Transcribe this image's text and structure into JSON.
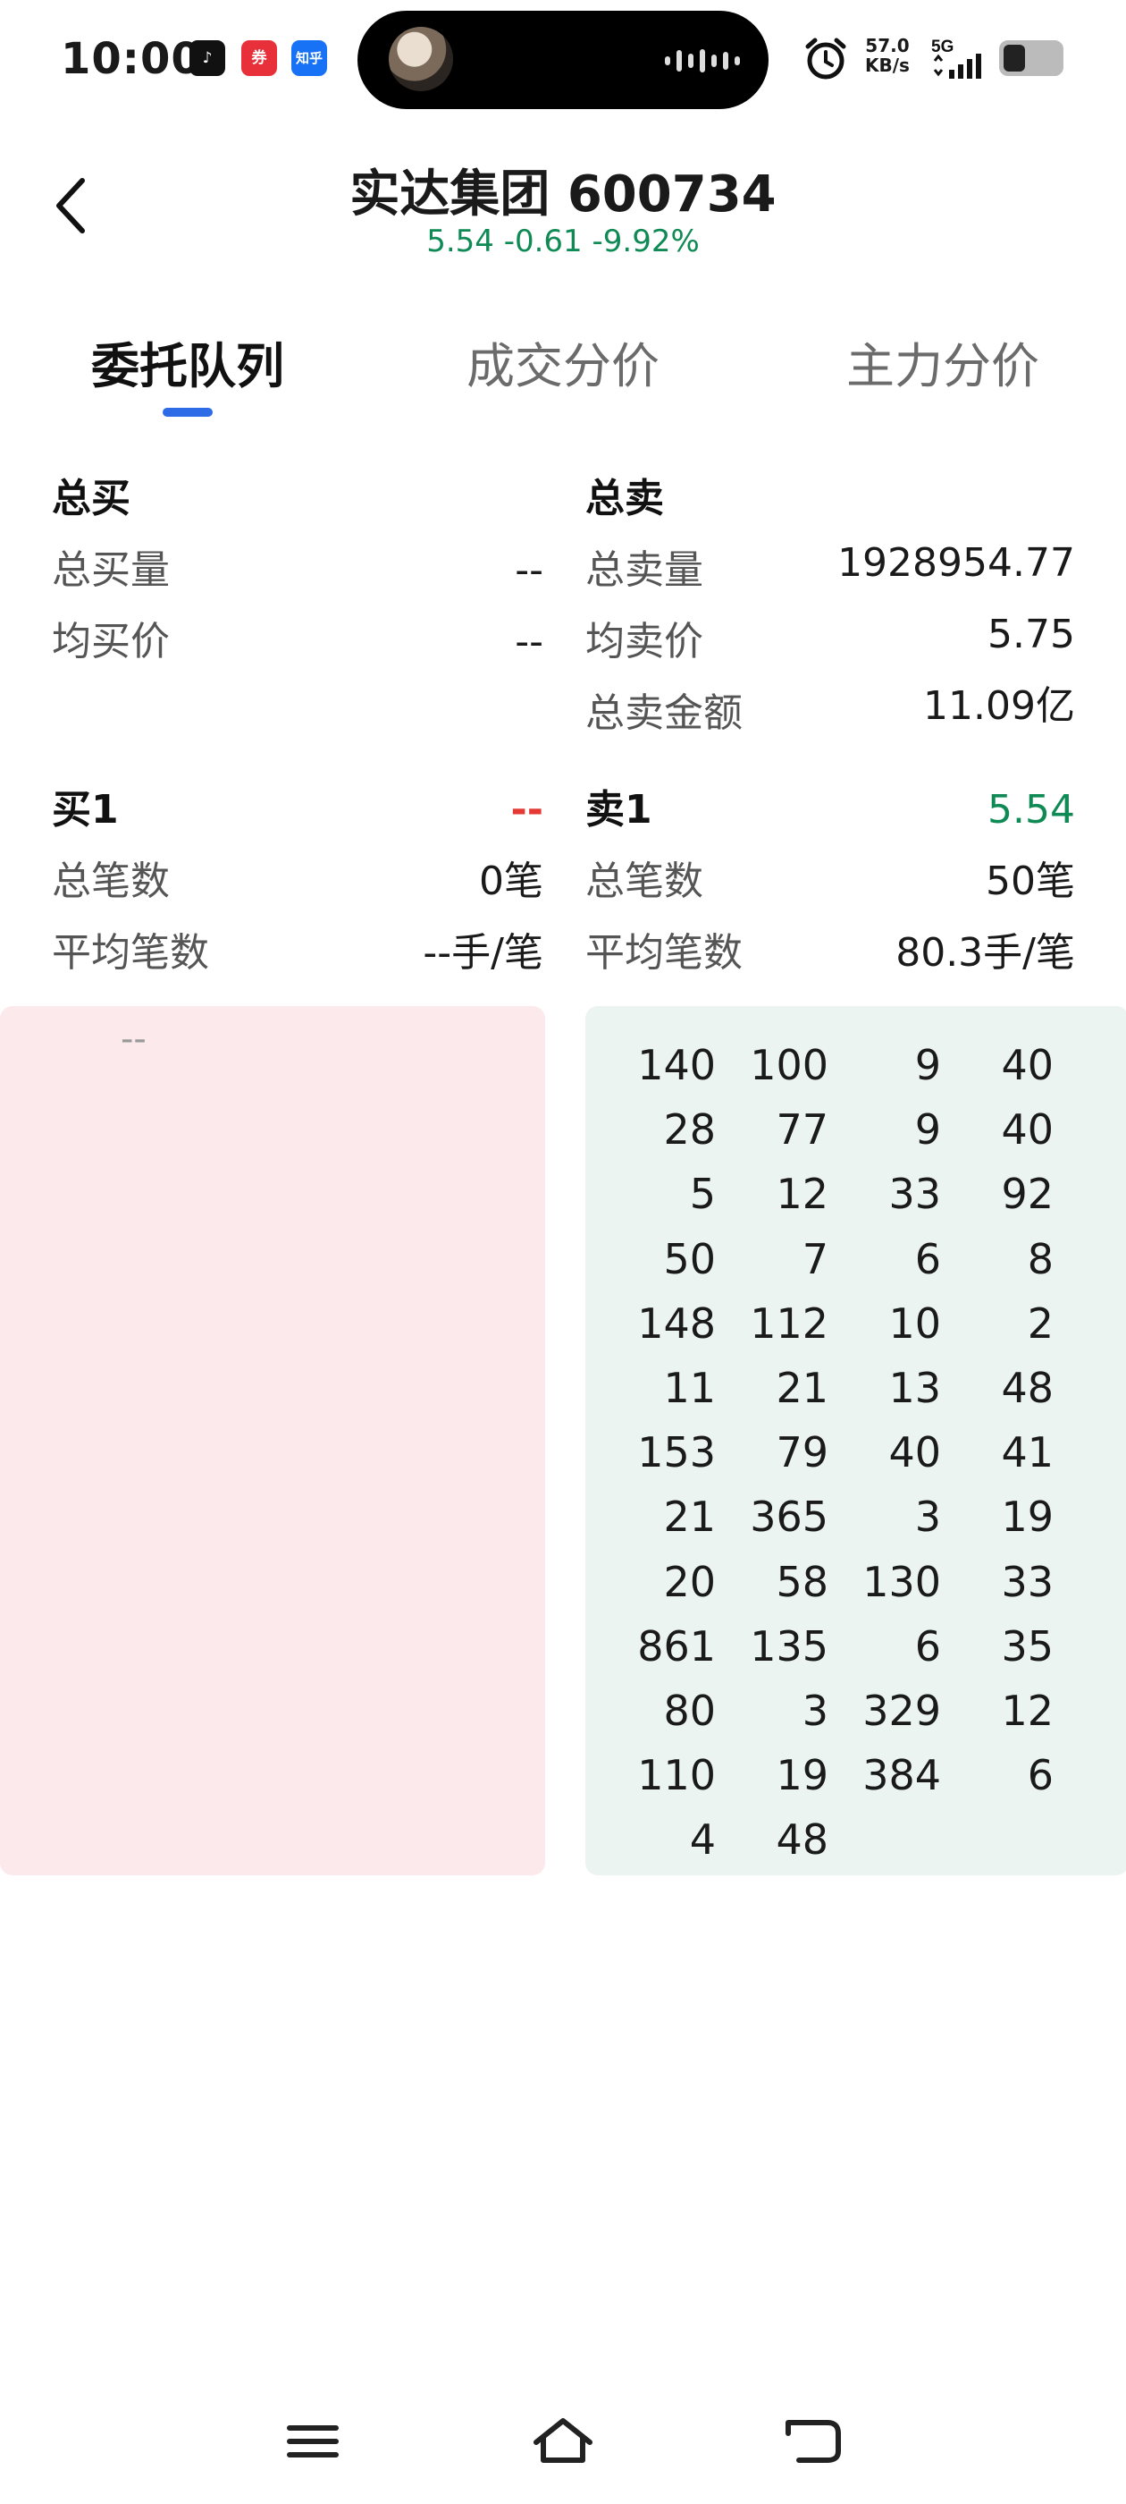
{
  "status_bar": {
    "time": "10:00",
    "apps": [
      {
        "name": "music-app-icon",
        "label": "♪",
        "color": "#111111"
      },
      {
        "name": "securities-app-icon",
        "label": "券",
        "color": "#e8303a"
      },
      {
        "name": "zhihu-app-icon",
        "label": "知乎",
        "color": "#1772f6"
      }
    ],
    "net_speed": "57.0",
    "net_unit": "KB/s",
    "network": "5G"
  },
  "header": {
    "title": "实达集团 600734",
    "quote": "5.54 -0.61 -9.92%"
  },
  "tabs": [
    {
      "label": "委托队列",
      "active": true
    },
    {
      "label": "成交分价",
      "active": false
    },
    {
      "label": "主力分价",
      "active": false
    }
  ],
  "buy_summary": {
    "heading": "总买",
    "volume_label": "总买量",
    "volume_value": "--",
    "avg_price_label": "均买价",
    "avg_price_value": "--"
  },
  "sell_summary": {
    "heading": "总卖",
    "volume_label": "总卖量",
    "volume_value": "1928954.77",
    "avg_price_label": "均卖价",
    "avg_price_value": "5.75",
    "amount_label": "总卖金额",
    "amount_value": "11.09亿"
  },
  "buy1": {
    "label": "买1",
    "price": "--",
    "count_label": "总笔数",
    "count_value": "0笔",
    "avg_label": "平均笔数",
    "avg_value": "--手/笔"
  },
  "sell1": {
    "label": "卖1",
    "price": "5.54",
    "count_label": "总笔数",
    "count_value": "50笔",
    "avg_label": "平均笔数",
    "avg_value": "80.3手/笔"
  },
  "buy_queue": {
    "empty_text": "--"
  },
  "sell_queue": {
    "values": [
      "140",
      "100",
      "9",
      "40",
      "28",
      "77",
      "9",
      "40",
      "5",
      "12",
      "33",
      "92",
      "50",
      "7",
      "6",
      "8",
      "148",
      "112",
      "10",
      "2",
      "11",
      "21",
      "13",
      "48",
      "153",
      "79",
      "40",
      "41",
      "21",
      "365",
      "3",
      "19",
      "20",
      "58",
      "130",
      "33",
      "861",
      "135",
      "6",
      "35",
      "80",
      "3",
      "329",
      "12",
      "110",
      "19",
      "384",
      "6",
      "4",
      "48"
    ]
  },
  "colors": {
    "up": "#e53935",
    "down": "#0f8a55",
    "accent": "#2e6be6",
    "buy_panel": "#fce9ec",
    "sell_panel": "#ebf4f1"
  }
}
